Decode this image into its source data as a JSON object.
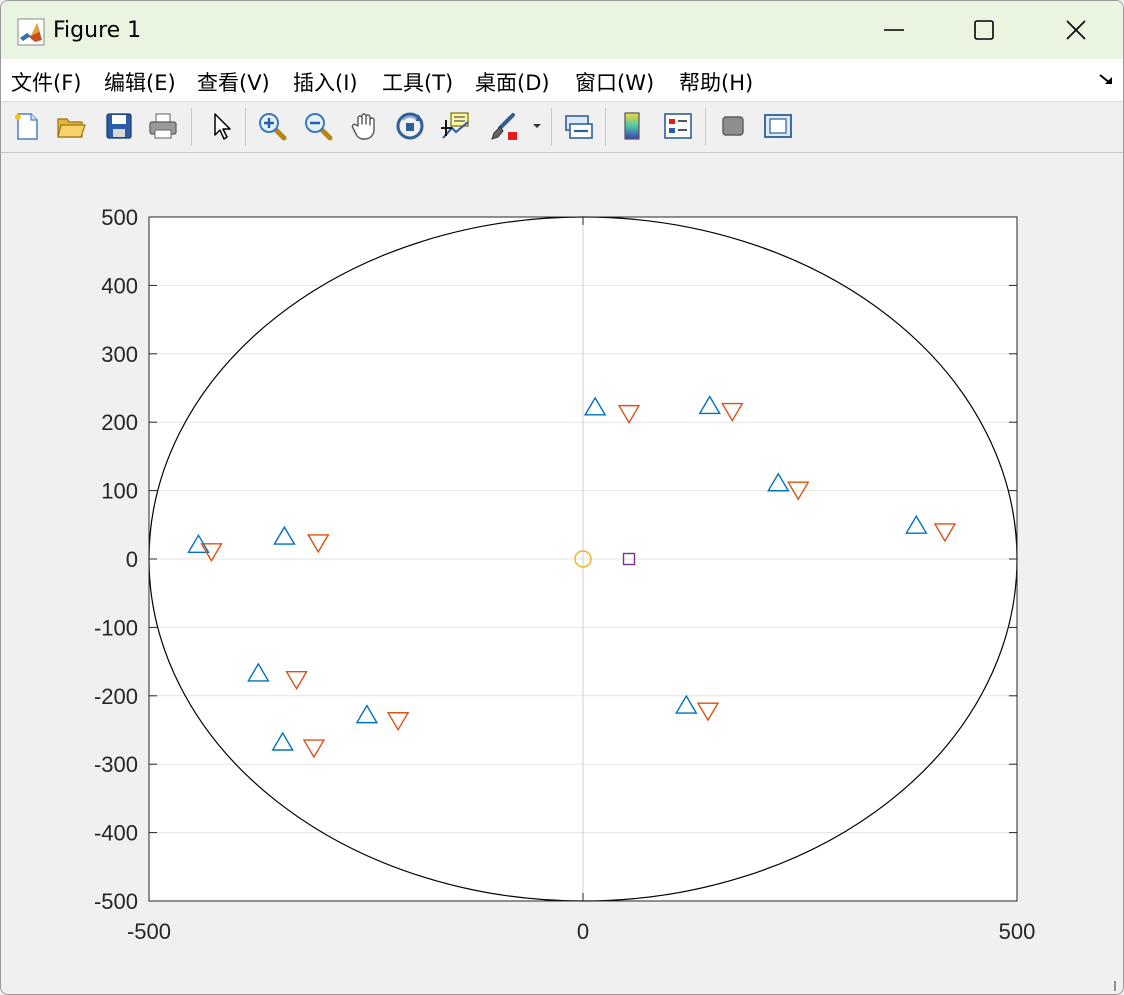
{
  "window": {
    "title": "Figure 1",
    "app_icon": "matlab-logo-icon",
    "controls": [
      "minimize-icon",
      "maximize-icon",
      "close-icon"
    ]
  },
  "menubar": {
    "items": [
      {
        "label": "文件(F)"
      },
      {
        "label": "编辑(E)"
      },
      {
        "label": "查看(V)"
      },
      {
        "label": "插入(I)"
      },
      {
        "label": "工具(T)"
      },
      {
        "label": "桌面(D)"
      },
      {
        "label": "窗口(W)"
      },
      {
        "label": "帮助(H)"
      }
    ],
    "dock_icon": "undock-arrow-icon"
  },
  "toolbar": {
    "icons": [
      "new-figure-icon",
      "open-file-icon",
      "save-icon",
      "print-icon",
      "edit-plot-pointer-icon",
      "zoom-in-icon",
      "zoom-out-icon",
      "pan-hand-icon",
      "rotate-3d-icon",
      "data-cursor-icon",
      "brush-icon",
      "brush-dropdown-icon",
      "link-plot-icon",
      "colorbar-icon",
      "legend-icon",
      "hide-plot-tools-icon",
      "show-plot-tools-icon"
    ]
  },
  "chart_data": {
    "type": "scatter",
    "xlim": [
      -500,
      500
    ],
    "ylim": [
      -500,
      500
    ],
    "xticks": [
      "-500",
      "0",
      "500"
    ],
    "yticks": [
      "500",
      "400",
      "300",
      "200",
      "100",
      "0",
      "-100",
      "-200",
      "-300",
      "-400",
      "-500"
    ],
    "grid": true,
    "colors": {
      "upward": "#0072bd",
      "downward": "#d95319",
      "circle": "#edb120",
      "square": "#7e2f8e",
      "boundary": "#000000",
      "crosshair": "#d0d0d0"
    },
    "boundary_ellipse": {
      "center": [
        0,
        0
      ],
      "rx": 500,
      "ry": 500
    },
    "series": [
      {
        "marker": "triangle-up",
        "points": [
          [
            -443,
            20
          ],
          [
            -344,
            32
          ],
          [
            -374,
            -168
          ],
          [
            -346,
            -269
          ],
          [
            -249,
            -229
          ],
          [
            14,
            221
          ],
          [
            146,
            223
          ],
          [
            225,
            110
          ],
          [
            384,
            48
          ],
          [
            119,
            -215
          ]
        ]
      },
      {
        "marker": "triangle-down",
        "points": [
          [
            -428,
            12
          ],
          [
            -305,
            25
          ],
          [
            -330,
            -175
          ],
          [
            -310,
            -275
          ],
          [
            -213,
            -235
          ],
          [
            53,
            214
          ],
          [
            172,
            217
          ],
          [
            248,
            102
          ],
          [
            417,
            41
          ],
          [
            144,
            -221
          ]
        ]
      },
      {
        "marker": "circle",
        "points": [
          [
            0,
            0
          ]
        ]
      },
      {
        "marker": "square",
        "points": [
          [
            53,
            0
          ]
        ]
      }
    ]
  }
}
